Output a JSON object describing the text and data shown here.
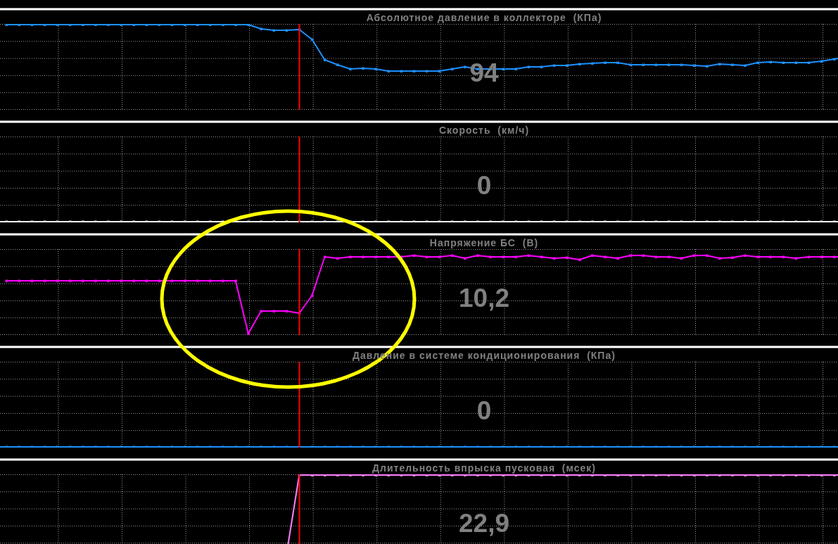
{
  "panels": [
    {
      "title": "Абсолютное давление в коллекторе  (КПа)",
      "value": "94",
      "color": "#1e90ff"
    },
    {
      "title": "Скорость  (км/ч)",
      "value": "0",
      "color": "#ffffff"
    },
    {
      "title": "Напряжение БС  (В)",
      "value": "10,2",
      "color": "#ff00ff"
    },
    {
      "title": "Давление в системе кондиционирования  (КПа)",
      "value": "0",
      "color": "#1e90ff"
    },
    {
      "title": "Длительность впрыска пусковая  (мсек)",
      "value": "22,9",
      "color": "#ff80ff"
    }
  ],
  "annotation": {
    "kind": "ellipse"
  }
}
